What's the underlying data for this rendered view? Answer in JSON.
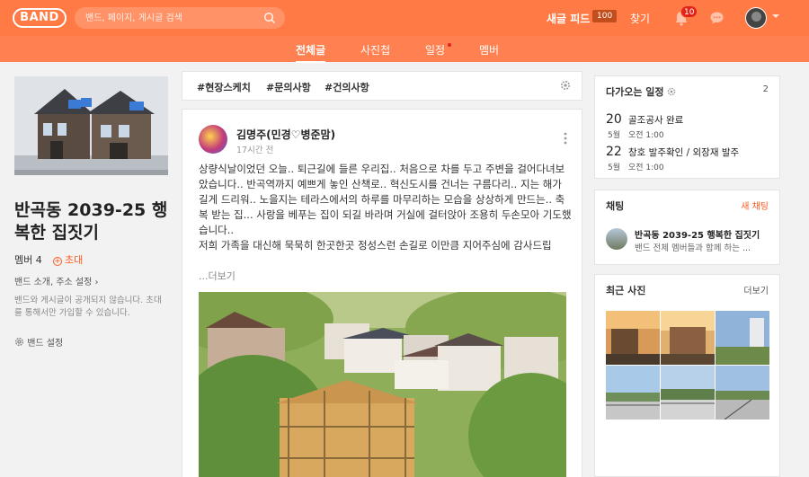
{
  "topbar": {
    "logo": "BAND",
    "search_placeholder": "밴드, 페이지, 게시글 검색",
    "feed_label": "새글 피드",
    "feed_count": "100",
    "find_label": "찾기",
    "notification_count": "10"
  },
  "tabs": [
    {
      "label": "전체글"
    },
    {
      "label": "사진첩"
    },
    {
      "label": "일정"
    },
    {
      "label": "멤버"
    }
  ],
  "band": {
    "title": "반곡동 2039-25 행복한 집짓기",
    "member_label": "멤버 4",
    "invite_label": "초대",
    "intro_label": "밴드 소개, 주소 설정",
    "privacy_note": "밴드와 게시글이 공개되지 않습니다. 초대를 통해서만 가입할 수 있습니다.",
    "settings_label": "밴드 설정"
  },
  "hashtags": [
    "#현장스케치",
    "#문의사항",
    "#건의사항"
  ],
  "post": {
    "author": "김명주(민경♡병준맘)",
    "time": "17시간 전",
    "body": "상량식날이었던 오늘.. 퇴근길에 들른 우리집.. 처음으로 차를 두고 주변을 걸어다녀보았습니다..  반곡역까지 예쁘게 놓인 산책로.. 혁신도시를 건너는 구름다리.. 지는 해가 길게 드리워.. 노을지는 테라스에서의 하루를 마무리하는 모습을 상상하게 만드는..  축복 받는 집... 사랑을 베푸는 집이 되길 바라며  거실에 걸터앉아 조용히 두손모아 기도했습니다..\n 저희 가족을 대신해 묵묵히 한곳한곳  정성스런 손길로 이만큼 지어주심에 감사드립",
    "more_label": "...더보기"
  },
  "schedule": {
    "title": "다가오는 일정",
    "count": "2",
    "items": [
      {
        "day": "20",
        "month": "5월",
        "title": "골조공사 완료",
        "time": "오전 1:00"
      },
      {
        "day": "22",
        "month": "5월",
        "title": "창호 발주확인 / 외장재 발주",
        "time": "오전 1:00"
      }
    ]
  },
  "chat": {
    "title": "채팅",
    "new_label": "새 채팅",
    "room_name": "반곡동 2039-25 행복한 집짓기",
    "room_sub": "밴드 전체 멤버들과 함께 하는 ..."
  },
  "photos": {
    "title": "최근 사진",
    "more_label": "더보기"
  },
  "colors": {
    "brand": "#ff7a45",
    "accent": "#ff5a1f"
  }
}
